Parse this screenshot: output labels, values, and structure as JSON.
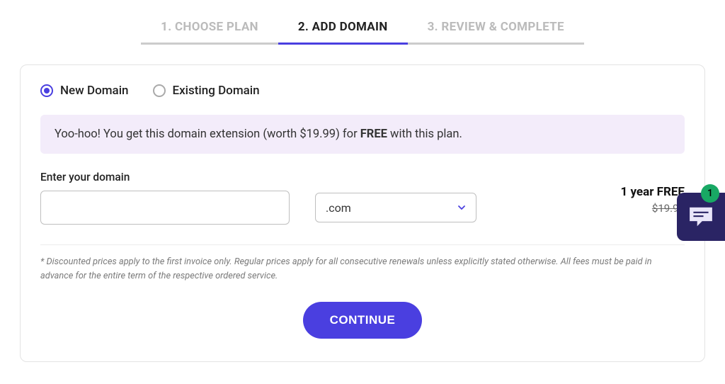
{
  "steps": [
    {
      "label": "1. CHOOSE PLAN",
      "active": false
    },
    {
      "label": "2. ADD DOMAIN",
      "active": true
    },
    {
      "label": "3. REVIEW & COMPLETE",
      "active": false
    }
  ],
  "radios": {
    "new": "New Domain",
    "existing": "Existing Domain"
  },
  "banner": {
    "prefix": "Yoo-hoo! You get this domain extension (worth $19.99) for ",
    "bold": "FREE",
    "suffix": " with this plan."
  },
  "form": {
    "label": "Enter your domain",
    "tld": ".com"
  },
  "price": {
    "headline": "1 year FREE",
    "strike": "$19.99"
  },
  "disclaimer": "* Discounted prices apply to the first invoice only. Regular prices apply for all consecutive renewals unless explicitly stated otherwise. All fees must be paid in advance for the entire term of the respective ordered service.",
  "continue_label": "CONTINUE",
  "chat": {
    "badge": "1"
  }
}
